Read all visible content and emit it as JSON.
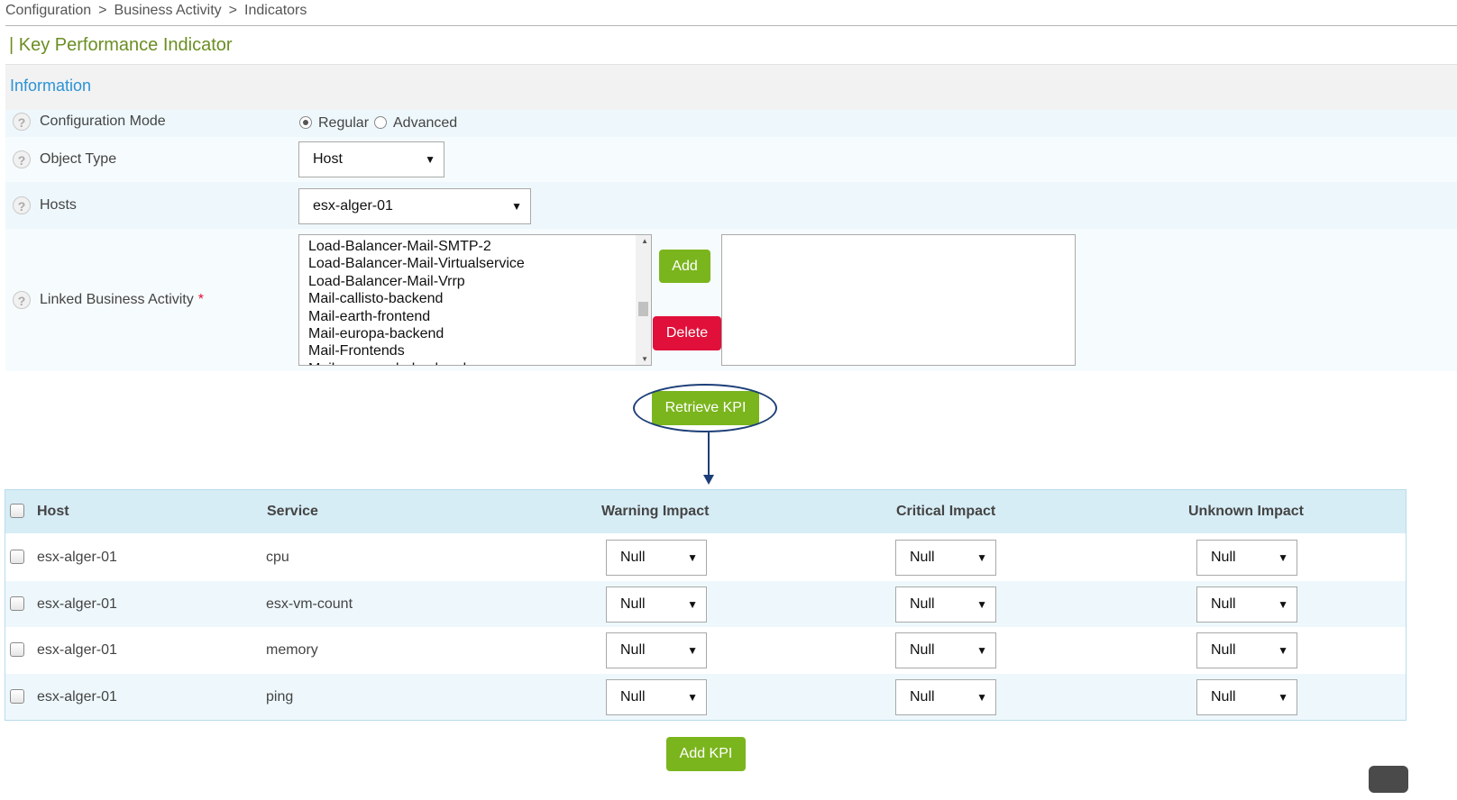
{
  "breadcrumb": [
    "Configuration",
    "Business Activity",
    "Indicators"
  ],
  "breadcrumb_separator": ">",
  "page_title": "| Key Performance Indicator",
  "section_title": "Information",
  "help_glyph": "?",
  "form": {
    "configuration_mode": {
      "label": "Configuration Mode",
      "options": [
        "Regular",
        "Advanced"
      ],
      "selected": "Regular"
    },
    "object_type": {
      "label": "Object Type",
      "value": "Host"
    },
    "hosts": {
      "label": "Hosts",
      "value": "esx-alger-01"
    },
    "linked_business_activity": {
      "label": "Linked Business Activity",
      "required_mark": "*",
      "available": [
        "Load-Balancer-Mail-SMTP-2",
        "Load-Balancer-Mail-Virtualservice",
        "Load-Balancer-Mail-Vrrp",
        "Mail-callisto-backend",
        "Mail-earth-frontend",
        "Mail-europa-backend",
        "Mail-Frontends",
        "Mail-ganymede-backend"
      ],
      "selected": []
    },
    "add_label": "Add",
    "delete_label": "Delete",
    "retrieve_label": "Retrieve KPI"
  },
  "table": {
    "headers": [
      "Host",
      "Service",
      "Warning Impact",
      "Critical Impact",
      "Unknown Impact"
    ],
    "rows": [
      {
        "host": "esx-alger-01",
        "service": "cpu",
        "warning": "Null",
        "critical": "Null",
        "unknown": "Null"
      },
      {
        "host": "esx-alger-01",
        "service": "esx-vm-count",
        "warning": "Null",
        "critical": "Null",
        "unknown": "Null"
      },
      {
        "host": "esx-alger-01",
        "service": "memory",
        "warning": "Null",
        "critical": "Null",
        "unknown": "Null"
      },
      {
        "host": "esx-alger-01",
        "service": "ping",
        "warning": "Null",
        "critical": "Null",
        "unknown": "Null"
      }
    ]
  },
  "add_kpi_label": "Add KPI",
  "icons": {
    "dropdown": "chevron-down-icon",
    "help": "help-icon",
    "callout": "arrow-down-icon"
  },
  "colors": {
    "title_green": "#6b8e23",
    "section_blue": "#2b93d6",
    "button_green": "#7ab51d",
    "button_red": "#e0103a",
    "row_alt": "#eef8fc",
    "header_bg": "#d7edf6",
    "highlight": "#1d3f78"
  }
}
